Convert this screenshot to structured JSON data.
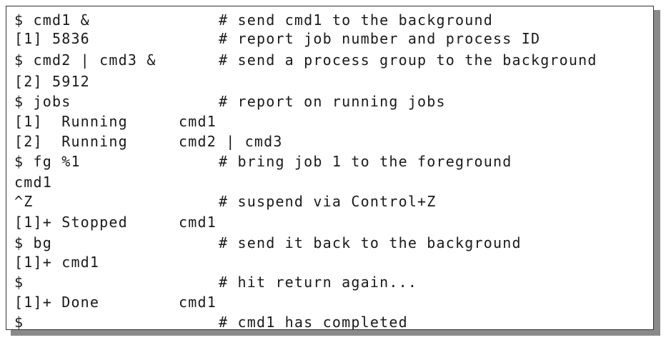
{
  "terminal": {
    "lines": [
      {
        "cmd": "$ cmd1 &",
        "comment": "# send cmd1 to the background"
      },
      {
        "cmd": "[1] 5836",
        "comment": "# report job number and process ID"
      },
      {
        "cmd": "$ cmd2 | cmd3 &",
        "comment": "# send a process group to the background"
      },
      {
        "cmd": "[2] 5912",
        "comment": ""
      },
      {
        "cmd": "$ jobs",
        "comment": "# report on running jobs"
      },
      {
        "cmd": "[1]  Running",
        "job": "cmd1"
      },
      {
        "cmd": "[2]  Running",
        "job": "cmd2 | cmd3"
      },
      {
        "cmd": "$ fg %1",
        "comment": "# bring job 1 to the foreground"
      },
      {
        "cmd": "cmd1",
        "comment": ""
      },
      {
        "cmd": "^Z",
        "comment": "# suspend via Control+Z"
      },
      {
        "cmd": "[1]+ Stopped",
        "job": "cmd1"
      },
      {
        "cmd": "$ bg",
        "comment": "# send it back to the background"
      },
      {
        "cmd": "[1]+ cmd1",
        "comment": ""
      },
      {
        "cmd": "$",
        "comment": "# hit return again..."
      },
      {
        "cmd": "[1]+ Done",
        "job": "cmd1"
      },
      {
        "cmd": "$",
        "comment": "# cmd1 has completed"
      }
    ]
  }
}
